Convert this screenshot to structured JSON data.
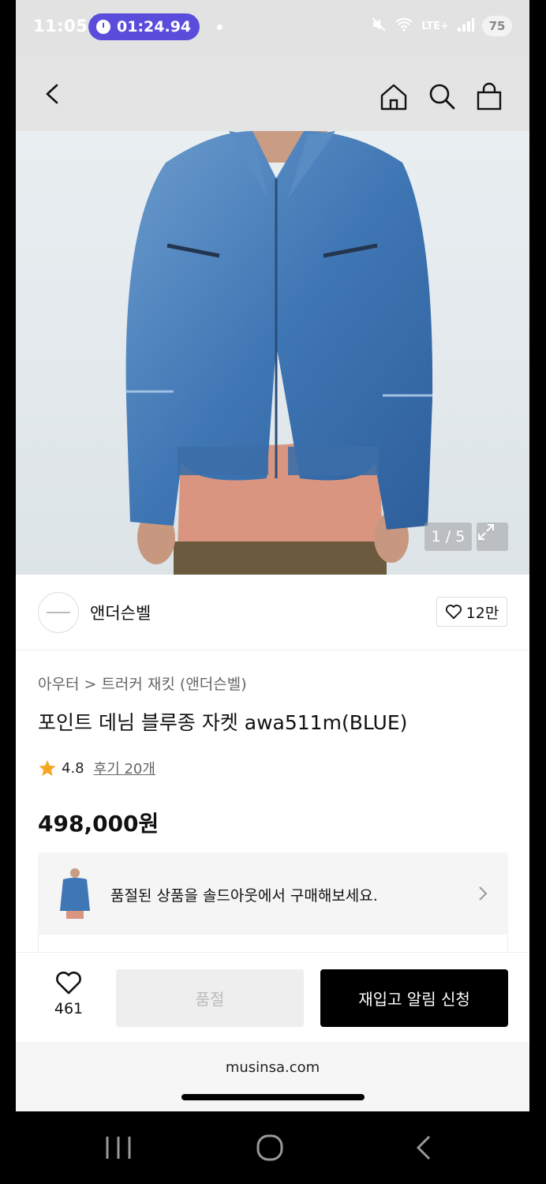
{
  "status_bar": {
    "time": "11:05",
    "timer": "01:24.94",
    "network": "LTE+",
    "battery": "75"
  },
  "nav": {
    "icons": [
      "back-icon",
      "home-icon",
      "search-icon",
      "bag-icon"
    ]
  },
  "gallery": {
    "counter": "1 / 5",
    "icons": [
      "expand-icon"
    ]
  },
  "brand": {
    "name": "앤더슨벨",
    "likes": "12만"
  },
  "product": {
    "breadcrumb": "아우터 > 트러커 재킷 (앤더슨벨)",
    "title": "포인트 데님 블루종 자켓 awa511m(BLUE)",
    "rating": "4.8",
    "reviews": "후기 20개",
    "price": "498,000원"
  },
  "soldout_banner": {
    "text": "품절된 상품을 솔드아웃에서 구매해보세요."
  },
  "actions": {
    "wish_count": "461",
    "soldout_label": "품절",
    "notify_label": "재입고 알림 신청"
  },
  "browser": {
    "url": "musinsa.com"
  },
  "colors": {
    "accent_purple": "#5b4ddb",
    "star": "#f5a623",
    "primary_button": "#000000"
  }
}
